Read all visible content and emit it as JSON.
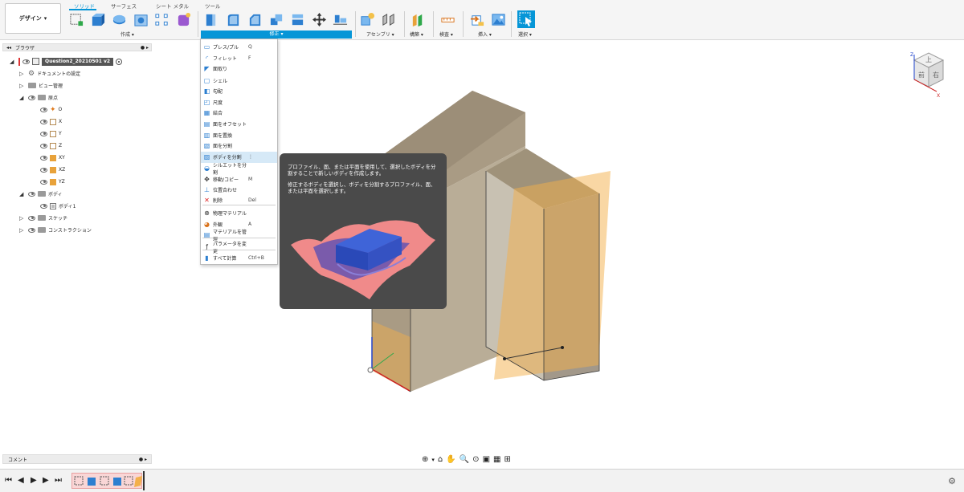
{
  "design_button": {
    "label": "デザイン",
    "caret": "▾"
  },
  "tabs": [
    {
      "label": "ソリッド",
      "active": true
    },
    {
      "label": "サーフェス"
    },
    {
      "label": "シート メタル"
    },
    {
      "label": "ツール"
    }
  ],
  "groups": {
    "create": "作成 ▾",
    "modify": "修正 ▾",
    "assemble": "アセンブリ ▾",
    "construct": "構築 ▾",
    "inspect": "検査 ▾",
    "insert": "挿入 ▾",
    "select": "選択 ▾"
  },
  "browser": {
    "title": "ブラウザ",
    "document_name": "Question2_20210501 v2",
    "items": [
      {
        "label": "ドキュメントの設定"
      },
      {
        "label": "ビュー管理"
      },
      {
        "label": "原点"
      },
      {
        "label": "O"
      },
      {
        "label": "X"
      },
      {
        "label": "Y"
      },
      {
        "label": "Z"
      },
      {
        "label": "XY"
      },
      {
        "label": "XZ"
      },
      {
        "label": "YZ"
      },
      {
        "label": "ボディ"
      },
      {
        "label": "ボディ1"
      },
      {
        "label": "スケッチ"
      },
      {
        "label": "コンストラクション"
      }
    ]
  },
  "modify_menu": {
    "items": [
      {
        "label": "プレス/プル",
        "key": "Q",
        "icon": "press-pull-icon"
      },
      {
        "label": "フィレット",
        "key": "F",
        "icon": "fillet-icon"
      },
      {
        "label": "面取り",
        "key": "",
        "icon": "chamfer-icon"
      },
      {
        "label": "シェル",
        "key": "",
        "icon": "shell-icon"
      },
      {
        "label": "勾配",
        "key": "",
        "icon": "draft-icon"
      },
      {
        "label": "尺度",
        "key": "",
        "icon": "scale-icon"
      },
      {
        "label": "結合",
        "key": "",
        "icon": "combine-icon"
      },
      {
        "label": "面をオフセット",
        "key": "",
        "icon": "offset-face-icon"
      },
      {
        "label": "面を置換",
        "key": "",
        "icon": "replace-face-icon"
      },
      {
        "label": "面を分割",
        "key": "",
        "icon": "split-face-icon"
      },
      {
        "label": "ボディを分割",
        "key": "⋮",
        "icon": "split-body-icon"
      },
      {
        "label": "シルエットを分割",
        "key": "",
        "icon": "silhouette-split-icon"
      },
      {
        "label": "移動/コピー",
        "key": "M",
        "icon": "move-icon"
      },
      {
        "label": "位置合わせ",
        "key": "",
        "icon": "align-icon"
      },
      {
        "label": "削除",
        "key": "Del",
        "icon": "delete-icon"
      },
      {
        "label": "物理マテリアル",
        "key": "",
        "icon": "physical-material-icon"
      },
      {
        "label": "外観",
        "key": "A",
        "icon": "appearance-icon"
      },
      {
        "label": "マテリアルを管理",
        "key": "",
        "icon": "manage-materials-icon"
      },
      {
        "label": "パラメータを変更",
        "key": "",
        "icon": "parameters-icon"
      },
      {
        "label": "すべて計算",
        "key": "Ctrl+B",
        "icon": "compute-all-icon"
      }
    ]
  },
  "tooltip": {
    "line1": "プロファイル、面、または平面を使用して、選択したボディを分割することで新しいボディを作成します。",
    "line2": "修正するボディを選択し、ボディを分割するプロファイル、面、または平面を選択します。"
  },
  "comments": {
    "label": "コメント"
  },
  "viewcube": {
    "front": "前",
    "right": "右",
    "top": "上",
    "axis_x": "X",
    "axis_z": "Z"
  },
  "colors": {
    "accent": "#0696d7",
    "body": "#b0a48c",
    "plane": "#f3b04a",
    "tooltip_bg": "#4a4a4a"
  }
}
